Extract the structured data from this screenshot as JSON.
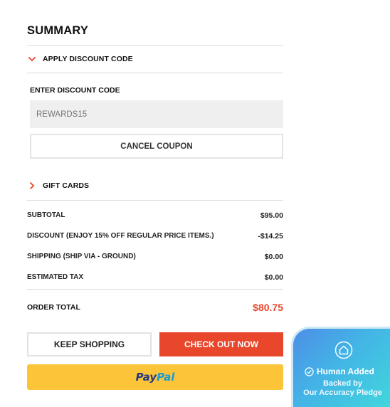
{
  "summary": {
    "title": "SUMMARY",
    "discount_section": {
      "toggle_label": "APPLY DISCOUNT CODE",
      "expanded": true,
      "field_label": "ENTER DISCOUNT CODE",
      "field_value": "",
      "field_placeholder": "REWARDS15",
      "cancel_label": "CANCEL COUPON"
    },
    "gift_cards": {
      "toggle_label": "GIFT CARDS",
      "expanded": false
    },
    "lines": [
      {
        "label": "SUBTOTAL",
        "amount": "$95.00"
      },
      {
        "label": "DISCOUNT (ENJOY 15% OFF REGULAR PRICE ITEMS.)",
        "amount": "-$14.25"
      },
      {
        "label": "SHIPPING (SHIP VIA - GROUND)",
        "amount": "$0.00"
      },
      {
        "label": "ESTIMATED TAX",
        "amount": "$0.00"
      }
    ],
    "order_total": {
      "label": "ORDER TOTAL",
      "amount": "$80.75"
    },
    "buttons": {
      "keep_shopping": "KEEP SHOPPING",
      "checkout": "CHECK OUT NOW",
      "paypal_part1": "Pay",
      "paypal_part2": "Pal"
    }
  },
  "badge": {
    "title": "Human Added",
    "subtitle_line1": "Backed by",
    "subtitle_line2": "Our Accuracy Pledge"
  },
  "colors": {
    "accent": "#e8472c",
    "paypal_yellow": "#fcc439",
    "paypal_dark_blue": "#253b80",
    "paypal_light_blue": "#179bd7",
    "divider": "#dcdcdc",
    "input_bg": "#efefef"
  },
  "icons": {
    "discount_toggle": "chevron-down-icon",
    "gift_toggle": "chevron-right-icon",
    "badge_main": "house-icon",
    "badge_check": "check-circle-icon"
  }
}
